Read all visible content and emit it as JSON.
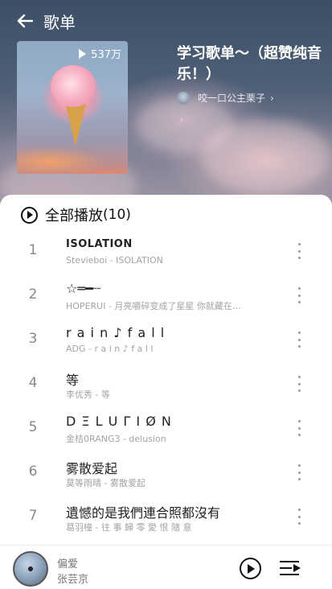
{
  "header": {
    "title": "歌单"
  },
  "playlist": {
    "play_count": "537万",
    "title": "学习歌单～（超赞纯音乐！）",
    "creator": "咬一口公主栗子",
    "creator_chevron": "›",
    "extra_chevron": "›"
  },
  "play_all": {
    "label": "全部播放",
    "count": "(10)"
  },
  "songs": [
    {
      "num": "1",
      "title": "ISOLATION",
      "subtitle": "Stevieboi - ISOLATION"
    },
    {
      "num": "2",
      "title": "☆═━┈",
      "subtitle": "HOPERUI - 月亮嚼碎变成了星星 你就藏在…"
    },
    {
      "num": "3",
      "title": "r a i n ♪ f a l l",
      "subtitle": "ADG - r a i n ♪ f a l l"
    },
    {
      "num": "4",
      "title": "等",
      "subtitle": "李优秀 - 等"
    },
    {
      "num": "5",
      "title": "D Ξ L U Γ I Ø N",
      "subtitle": "金桔0RANG3 - delusion"
    },
    {
      "num": "6",
      "title": "雾散爱起",
      "subtitle": "莫等雨晴 - 雾散爱起"
    },
    {
      "num": "7",
      "title": "遺憾的是我們連合照都沒有",
      "subtitle": "葛羽橦 - 往 事 歸 零 愛 恨 隨 意"
    }
  ],
  "player": {
    "song": "偏爱",
    "artist": "张芸京"
  },
  "icons": {
    "back": "back-arrow-icon",
    "play_count": "play-triangle-icon",
    "play_all": "play-circle-icon",
    "more": "more-vertical-icon",
    "player_play": "play-circle-icon",
    "queue": "playlist-queue-icon"
  }
}
